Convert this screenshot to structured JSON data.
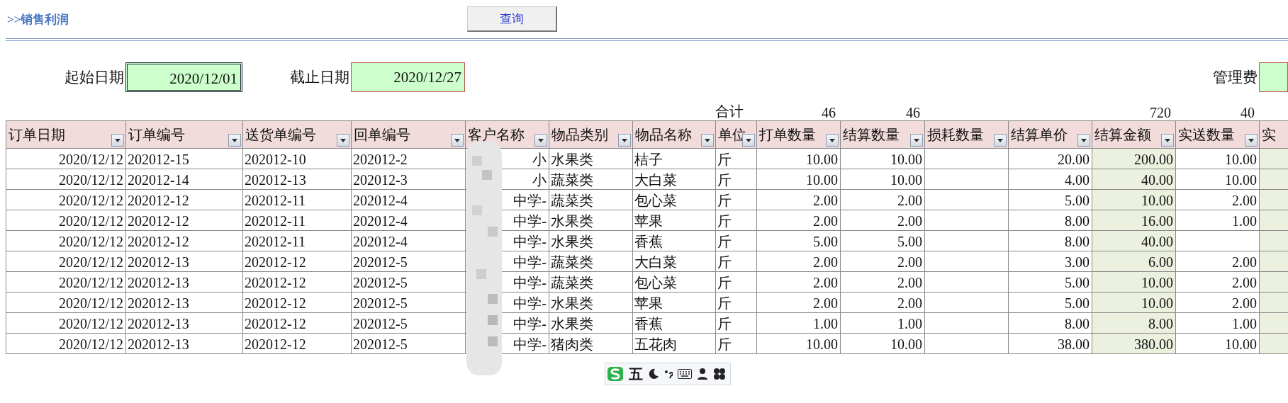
{
  "header": {
    "title": ">>销售利润",
    "query_button": "查询"
  },
  "filters": [
    {
      "label": "起始日期",
      "value": "2020/12/01",
      "selected": true
    },
    {
      "label": "截止日期",
      "value": "2020/12/27",
      "selected": false
    },
    {
      "label": "管理费",
      "selected": false
    }
  ],
  "total_label": "合计",
  "columns": [
    {
      "label": "订单日期"
    },
    {
      "label": "订单编号"
    },
    {
      "label": "送货单编号"
    },
    {
      "label": "回单编号"
    },
    {
      "label": "客户名称"
    },
    {
      "label": "物品类别"
    },
    {
      "label": "物品名称"
    },
    {
      "label": "单位"
    },
    {
      "label": "打单数量",
      "total": "46"
    },
    {
      "label": "结算数量",
      "total": "46"
    },
    {
      "label": "损耗数量"
    },
    {
      "label": "结算单价"
    },
    {
      "label": "结算金额",
      "total": "720"
    },
    {
      "label": "实送数量",
      "total": "40"
    },
    {
      "label": "实"
    }
  ],
  "rows": [
    [
      "2020/12/12",
      "202012-15",
      "202012-10",
      "202012-2",
      "小",
      "水果类",
      "桔子",
      "斤",
      "10.00",
      "10.00",
      null,
      "20.00",
      "200.00",
      "10.00",
      null
    ],
    [
      "2020/12/12",
      "202012-14",
      "202012-13",
      "202012-3",
      "小",
      "蔬菜类",
      "大白菜",
      "斤",
      "10.00",
      "10.00",
      null,
      "4.00",
      "40.00",
      "10.00",
      null
    ],
    [
      "2020/12/12",
      "202012-12",
      "202012-11",
      "202012-4",
      "中学-",
      "蔬菜类",
      "包心菜",
      "斤",
      "2.00",
      "2.00",
      null,
      "5.00",
      "10.00",
      "2.00",
      null
    ],
    [
      "2020/12/12",
      "202012-12",
      "202012-11",
      "202012-4",
      "中学-",
      "水果类",
      "苹果",
      "斤",
      "2.00",
      "2.00",
      null,
      "8.00",
      "16.00",
      "1.00",
      null
    ],
    [
      "2020/12/12",
      "202012-12",
      "202012-11",
      "202012-4",
      "中学-",
      "水果类",
      "香蕉",
      "斤",
      "5.00",
      "5.00",
      null,
      "8.00",
      "40.00",
      null,
      null
    ],
    [
      "2020/12/12",
      "202012-13",
      "202012-12",
      "202012-5",
      "中学-",
      "蔬菜类",
      "大白菜",
      "斤",
      "2.00",
      "2.00",
      null,
      "3.00",
      "6.00",
      "2.00",
      null
    ],
    [
      "2020/12/12",
      "202012-13",
      "202012-12",
      "202012-5",
      "中学-",
      "蔬菜类",
      "包心菜",
      "斤",
      "2.00",
      "2.00",
      null,
      "5.00",
      "10.00",
      "2.00",
      null
    ],
    [
      "2020/12/12",
      "202012-13",
      "202012-12",
      "202012-5",
      "中学-",
      "水果类",
      "苹果",
      "斤",
      "2.00",
      "2.00",
      null,
      "5.00",
      "10.00",
      "2.00",
      null
    ],
    [
      "2020/12/12",
      "202012-13",
      "202012-12",
      "202012-5",
      "中学-",
      "水果类",
      "香蕉",
      "斤",
      "1.00",
      "1.00",
      null,
      "8.00",
      "8.00",
      "1.00",
      null
    ],
    [
      "2020/12/12",
      "202012-13",
      "202012-12",
      "202012-5",
      "中学-",
      "猪肉类",
      "五花肉",
      "斤",
      "10.00",
      "10.00",
      null,
      "38.00",
      "380.00",
      "10.00",
      null
    ]
  ],
  "ime_toolbar": {
    "mode": "五"
  }
}
